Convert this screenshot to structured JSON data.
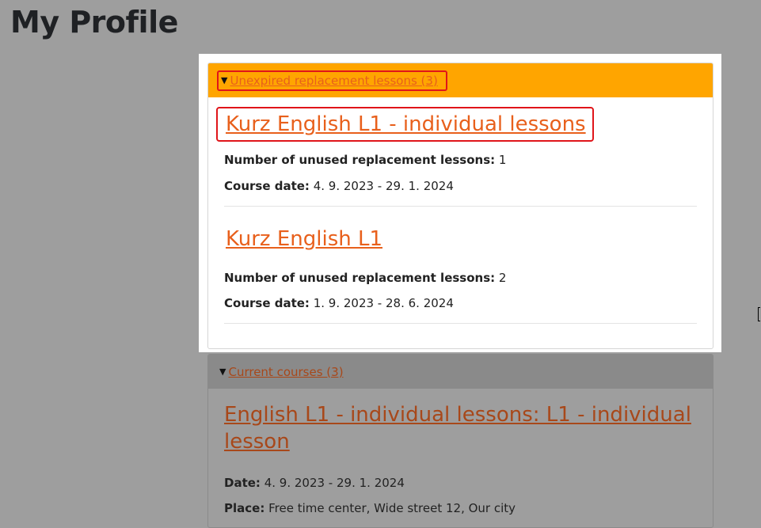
{
  "page": {
    "title": "My Profile"
  },
  "replacement_panel": {
    "header": "Unexpired replacement lessons (3)",
    "courses": [
      {
        "title": "Kurz English L1 - individual lessons",
        "unused_label": "Number of unused replacement lessons:",
        "unused_value": "1",
        "date_label": "Course date:",
        "date_value": "4. 9. 2023 - 29. 1. 2024"
      },
      {
        "title": "Kurz English L1",
        "unused_label": "Number of unused replacement lessons:",
        "unused_value": "2",
        "date_label": "Course date:",
        "date_value": "1. 9. 2023 - 28. 6. 2024"
      }
    ]
  },
  "current_panel": {
    "header": "Current courses (3)",
    "courses": [
      {
        "title": "English L1 - individual lessons: L1 - individual lesson",
        "date_label": "Date:",
        "date_value": "4. 9. 2023 - 29. 1. 2024",
        "place_label": "Place:",
        "place_value": "Free time center, Wide street 12, Our city"
      }
    ]
  },
  "colors": {
    "accent_orange": "#ffa500",
    "link_orange": "#e8601c",
    "highlight_red": "#e0151a",
    "overlay_gray": "#9e9e9e"
  },
  "icons": {
    "expand": "triangle-down-icon"
  }
}
